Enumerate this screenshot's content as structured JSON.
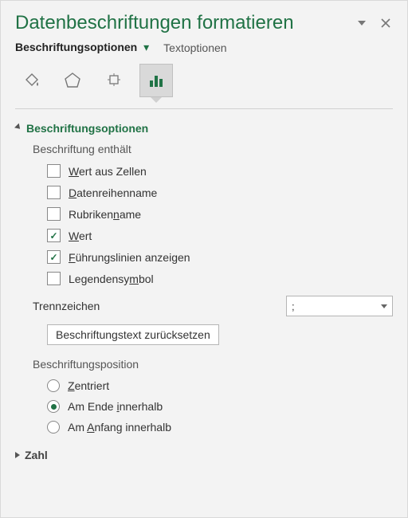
{
  "header": {
    "title": "Datenbeschriftungen formatieren"
  },
  "tabs": {
    "options": "Beschriftungsoptionen",
    "text": "Textoptionen"
  },
  "sections": {
    "label_options": {
      "title": "Beschriftungsoptionen",
      "contains_title": "Beschriftung enthält",
      "items": {
        "value_from_cells": "Wert aus Zellen",
        "series_name": "Datenreihenname",
        "category_name": "Rubrikenname",
        "value": "Wert",
        "leader_lines": "Führungslinien anzeigen",
        "legend_key": "Legendensymbol"
      },
      "separator_label": "Trennzeichen",
      "separator_value": ";",
      "reset_label": "Beschriftungstext zurücksetzen",
      "position_title": "Beschriftungsposition",
      "positions": {
        "center": "Zentriert",
        "inside_end": "Am Ende innerhalb",
        "inside_base": "Am Anfang innerhalb"
      }
    },
    "number": {
      "title": "Zahl"
    }
  },
  "state": {
    "checked": {
      "value_from_cells": false,
      "series_name": false,
      "category_name": false,
      "value": true,
      "leader_lines": true,
      "legend_key": false
    },
    "position_selected": "inside_end"
  }
}
